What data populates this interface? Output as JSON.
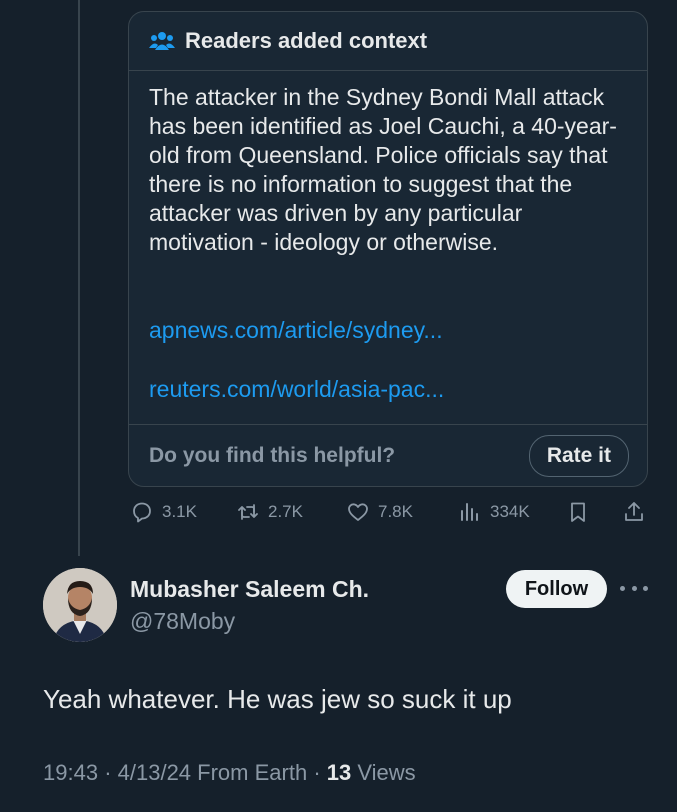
{
  "note": {
    "title": "Readers added context",
    "body": "The attacker in the Sydney Bondi Mall attack has been identified as Joel Cauchi, a 40-year-old from Queensland. Police officials say that there is no information to suggest that the attacker was driven by any particular motivation - ideology or otherwise.",
    "links": [
      "apnews.com/article/sydney...",
      "reuters.com/world/asia-pac..."
    ],
    "question": "Do you find this helpful?",
    "rate_label": "Rate it"
  },
  "actions": {
    "replies": "3.1K",
    "reposts": "2.7K",
    "likes": "7.8K",
    "views": "334K"
  },
  "reply": {
    "name": "Mubasher Saleem Ch.",
    "handle": "@78Moby",
    "follow_label": "Follow",
    "text": "Yeah whatever. He was jew so suck it up",
    "time": "19:43",
    "date": "4/13/24",
    "location": "From Earth",
    "views_count": "13",
    "views_label": "Views"
  },
  "colors": {
    "background": "#15202b",
    "link": "#1d9bf0",
    "secondary_text": "#8b98a5",
    "border": "#38444d"
  },
  "icons": [
    "people-icon",
    "reply-icon",
    "repost-icon",
    "like-icon",
    "views-icon",
    "bookmark-icon",
    "share-icon",
    "more-icon"
  ]
}
